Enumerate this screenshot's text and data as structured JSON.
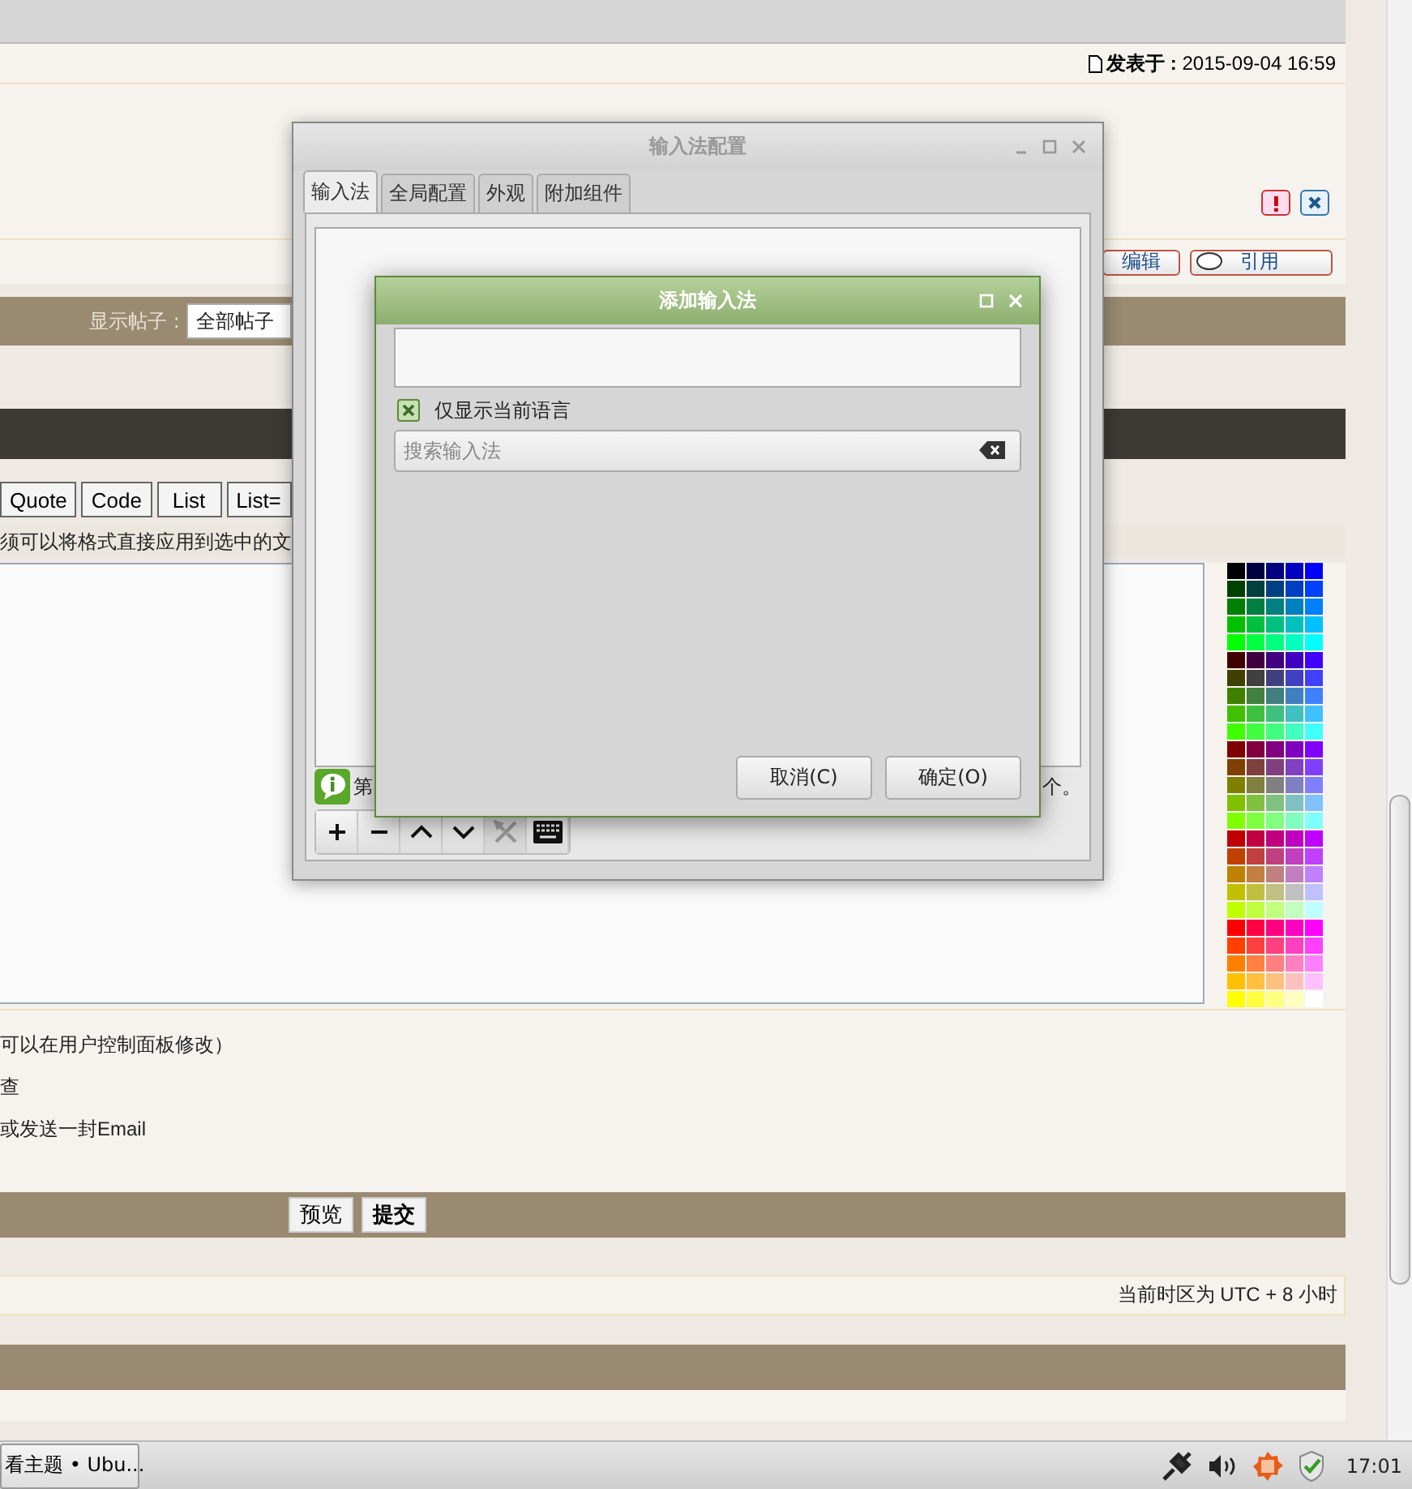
{
  "post": {
    "posted": "**发表于 :** 2015-09-04 16:59"
  },
  "post_actions": [
    "编辑",
    "引用"
  ],
  "filter": {
    "label": "显示帖子 :",
    "value": "全部帖子"
  },
  "format_buttons": [
    "Quote",
    "Code",
    "List",
    "List="
  ],
  "format_hint": "须可以将格式直接应用到选中的文",
  "palette": [
    {
      "color": "#000000"
    },
    {
      "color": "#000040"
    },
    {
      "color": "#000080"
    },
    {
      "color": "#0000c0"
    },
    {
      "color": "#0000ff"
    },
    {
      "color": "#004000"
    },
    {
      "color": "#004040"
    },
    {
      "color": "#004080"
    },
    {
      "color": "#0040c0"
    },
    {
      "color": "#0040ff"
    },
    {
      "color": "#008000"
    },
    {
      "color": "#008040"
    },
    {
      "color": "#008080"
    },
    {
      "color": "#0080c0"
    },
    {
      "color": "#0080ff"
    },
    {
      "color": "#00c000"
    },
    {
      "color": "#00c040"
    },
    {
      "color": "#00c080"
    },
    {
      "color": "#00c0c0"
    },
    {
      "color": "#00c0ff"
    },
    {
      "color": "#00ff00"
    },
    {
      "color": "#00ff40"
    },
    {
      "color": "#00ff80"
    },
    {
      "color": "#00ffc0"
    },
    {
      "color": "#00ffff"
    },
    {
      "color": "#400000"
    },
    {
      "color": "#400040"
    },
    {
      "color": "#400080"
    },
    {
      "color": "#4000c0"
    },
    {
      "color": "#4000ff"
    },
    {
      "color": "#404000"
    },
    {
      "color": "#404040"
    },
    {
      "color": "#404080"
    },
    {
      "color": "#4040c0"
    },
    {
      "color": "#4040ff"
    },
    {
      "color": "#408000"
    },
    {
      "color": "#408040"
    },
    {
      "color": "#408080"
    },
    {
      "color": "#4080c0"
    },
    {
      "color": "#4080ff"
    },
    {
      "color": "#40c000"
    },
    {
      "color": "#40c040"
    },
    {
      "color": "#40c080"
    },
    {
      "color": "#40c0c0"
    },
    {
      "color": "#40c0ff"
    },
    {
      "color": "#40ff00"
    },
    {
      "color": "#40ff40"
    },
    {
      "color": "#40ff80"
    },
    {
      "color": "#40ffc0"
    },
    {
      "color": "#40ffff"
    },
    {
      "color": "#800000"
    },
    {
      "color": "#800040"
    },
    {
      "color": "#800080"
    },
    {
      "color": "#8000c0"
    },
    {
      "color": "#8000ff"
    },
    {
      "color": "#804000"
    },
    {
      "color": "#804040"
    },
    {
      "color": "#804080"
    },
    {
      "color": "#8040c0"
    },
    {
      "color": "#8040ff"
    },
    {
      "color": "#808000"
    },
    {
      "color": "#808040"
    },
    {
      "color": "#808080"
    },
    {
      "color": "#8080c0"
    },
    {
      "color": "#8080ff"
    },
    {
      "color": "#80c000"
    },
    {
      "color": "#80c040"
    },
    {
      "color": "#80c080"
    },
    {
      "color": "#80c0c0"
    },
    {
      "color": "#80c0ff"
    },
    {
      "color": "#80ff00"
    },
    {
      "color": "#80ff40"
    },
    {
      "color": "#80ff80"
    },
    {
      "color": "#80ffc0"
    },
    {
      "color": "#80ffff"
    },
    {
      "color": "#c00000"
    },
    {
      "color": "#c00040"
    },
    {
      "color": "#c00080"
    },
    {
      "color": "#c000c0"
    },
    {
      "color": "#c000ff"
    },
    {
      "color": "#c04000"
    },
    {
      "color": "#c04040"
    },
    {
      "color": "#c04080"
    },
    {
      "color": "#c040c0"
    },
    {
      "color": "#c040ff"
    },
    {
      "color": "#c08000"
    },
    {
      "color": "#c08040"
    },
    {
      "color": "#c08080"
    },
    {
      "color": "#c080c0"
    },
    {
      "color": "#c080ff"
    },
    {
      "color": "#c0c000"
    },
    {
      "color": "#c0c040"
    },
    {
      "color": "#c0c080"
    },
    {
      "color": "#c0c0c0"
    },
    {
      "color": "#c0c0ff"
    },
    {
      "color": "#c0ff00"
    },
    {
      "color": "#c0ff40"
    },
    {
      "color": "#c0ff80"
    },
    {
      "color": "#c0ffc0"
    },
    {
      "color": "#c0ffff"
    },
    {
      "color": "#ff0000"
    },
    {
      "color": "#ff0040"
    },
    {
      "color": "#ff0080"
    },
    {
      "color": "#ff00c0"
    },
    {
      "color": "#ff00ff"
    },
    {
      "color": "#ff4000"
    },
    {
      "color": "#ff4040"
    },
    {
      "color": "#ff4080"
    },
    {
      "color": "#ff40c0"
    },
    {
      "color": "#ff40ff"
    },
    {
      "color": "#ff8000"
    },
    {
      "color": "#ff8040"
    },
    {
      "color": "#ff8080"
    },
    {
      "color": "#ff80c0"
    },
    {
      "color": "#ff80ff"
    },
    {
      "color": "#ffc000"
    },
    {
      "color": "#ffc040"
    },
    {
      "color": "#ffc080"
    },
    {
      "color": "#ffc0c0"
    },
    {
      "color": "#ffc0ff"
    },
    {
      "color": "#ffff00"
    },
    {
      "color": "#ffff40"
    },
    {
      "color": "#ffff80"
    },
    {
      "color": "#ffffc0"
    },
    {
      "color": "#ffffff"
    }
  ],
  "options": [
    "可以在用户控制面板修改）",
    "查",
    "或发送一封Email"
  ],
  "submit_buttons": [
    {
      "label": "预览",
      "kind": "normal"
    },
    {
      "label": "提交",
      "kind": "primary"
    }
  ],
  "timezone": "当前时区为 UTC + 8 小时",
  "taskbar": {
    "task": "看主题 • Ubu...",
    "clock": "17:01"
  },
  "config_window": {
    "title": "输入法配置",
    "tabs": [
      {
        "label": "输入法",
        "selected": true
      },
      {
        "label": "全局配置",
        "selected": false
      },
      {
        "label": "外观",
        "selected": false
      },
      {
        "label": "附加组件",
        "selected": false
      }
    ],
    "info_left": "第",
    "info_right": "个。",
    "toolbar": [
      {
        "kind": "add",
        "disabled": false
      },
      {
        "kind": "remove",
        "disabled": false
      },
      {
        "kind": "up",
        "disabled": false
      },
      {
        "kind": "down",
        "disabled": false
      },
      {
        "kind": "configure",
        "disabled": true
      },
      {
        "kind": "keyboard",
        "disabled": false
      }
    ]
  },
  "add_dialog": {
    "title": "添加输入法",
    "only_current_language": {
      "label": "仅显示当前语言",
      "checked": true
    },
    "search": {
      "placeholder": "搜索输入法"
    },
    "buttons": [
      "取消(C)",
      "确定(O)"
    ]
  }
}
